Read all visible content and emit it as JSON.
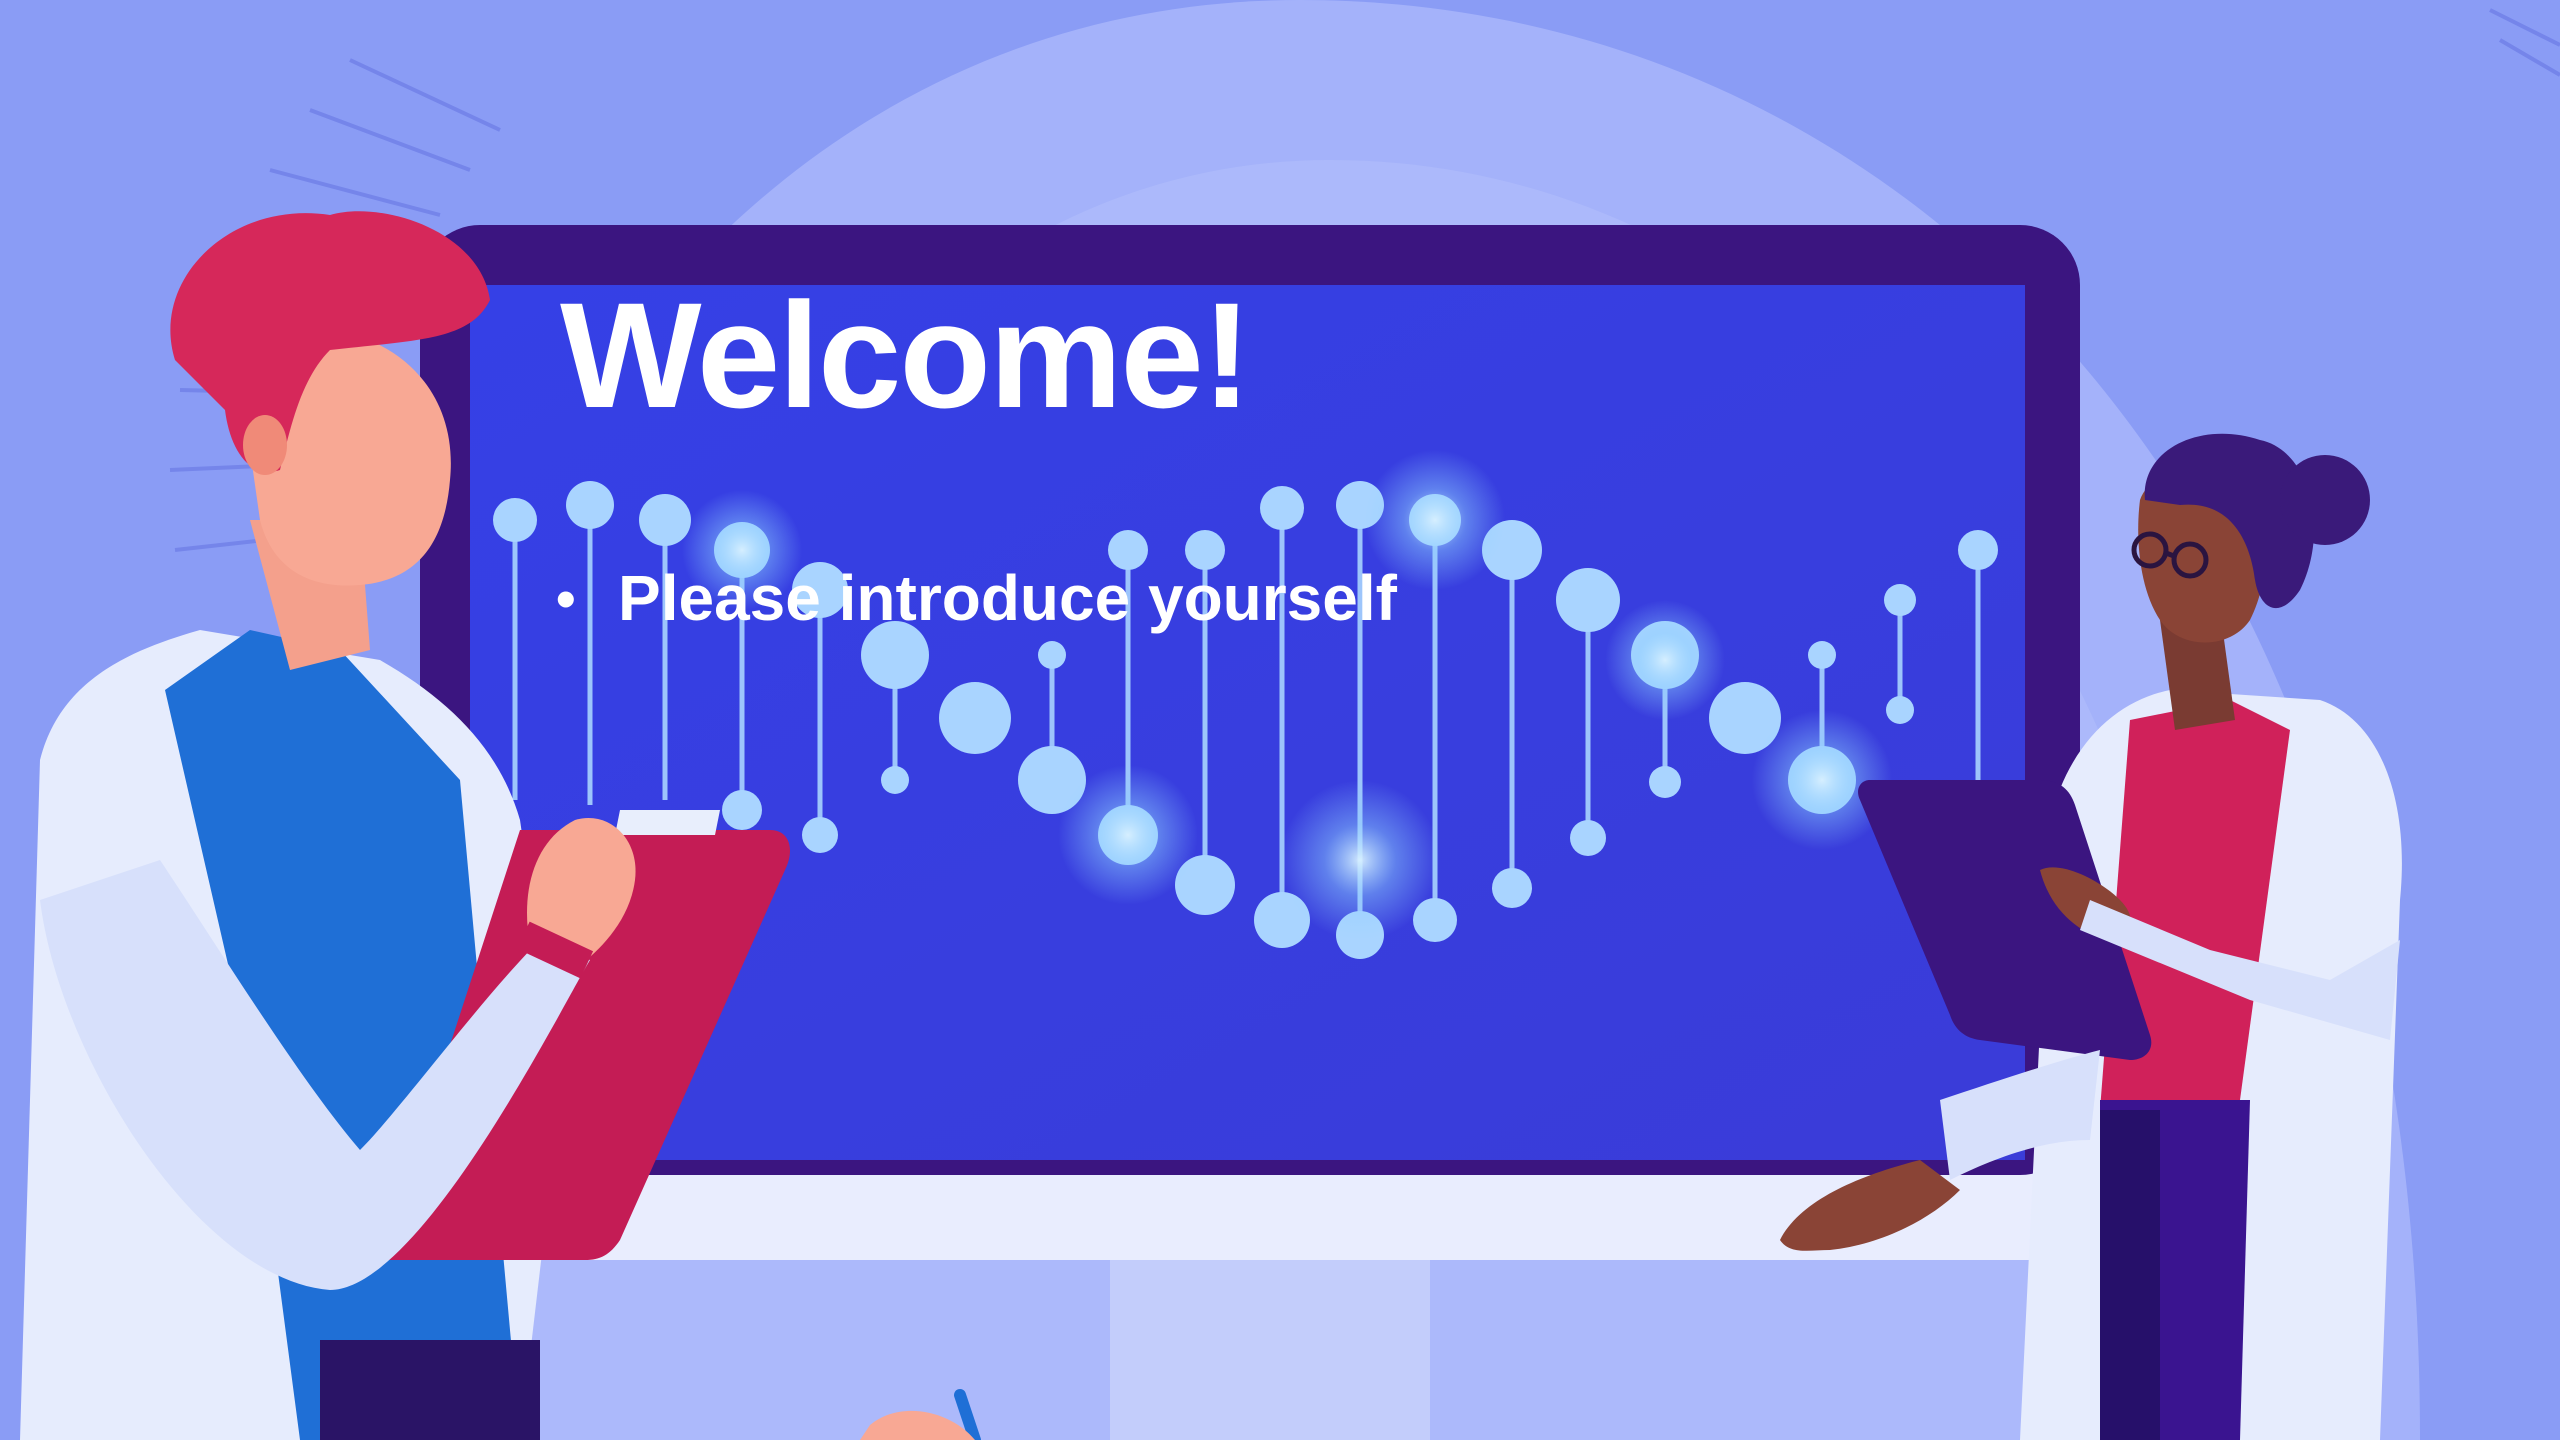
{
  "slide": {
    "title": "Welcome!",
    "bullets": [
      "Please introduce yourself"
    ],
    "bullet_symbol": "•"
  },
  "colors": {
    "background": "#8b9cf4",
    "monitor_frame": "#3b1580",
    "monitor_screen": "#3a3fe0",
    "dna_accent": "#a9d6ff",
    "text": "#ffffff",
    "coat": "#e8eefc",
    "red_accent": "#c41c55",
    "shirt_blue": "#1f6fd6"
  },
  "illustration": {
    "subject": "two scientists in lab coats beside a large monitor displaying a DNA helix",
    "icons": [
      "dna-helix-icon",
      "clipboard-icon",
      "tablet-icon",
      "glasses-icon"
    ]
  }
}
